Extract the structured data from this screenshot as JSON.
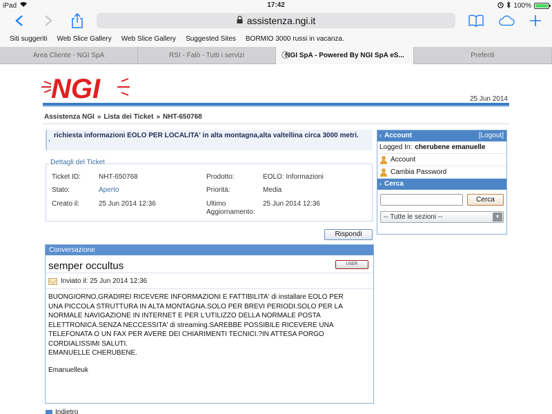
{
  "status_bar": {
    "device": "iPad",
    "time": "17:42",
    "battery": "100%",
    "battery_level": 1.0
  },
  "browser": {
    "url": "assistenza.ngi.it",
    "bookmarks": [
      "Siti suggeriti",
      "Web Slice Gallery",
      "Web Slice Gallery",
      "Suggested Sites",
      "BORMIO 3000 russi in vacanza."
    ],
    "tabs": [
      {
        "label": "Area Cliente - NGI SpA"
      },
      {
        "label": "RSI - Falò - Tutti i servizi"
      },
      {
        "label": "NGI SpA - Powered By NGI SpA eS..."
      },
      {
        "label": "Preferiti"
      }
    ]
  },
  "header": {
    "logo_text": "NGI",
    "date": "25 Jun 2014"
  },
  "breadcrumb": [
    "Assistenza NGI",
    "»",
    "Lista dei Ticket",
    "»",
    "NHT-650768"
  ],
  "ticket": {
    "subject": "richiesta informazioni EOLO PER LOCALITA' in alta montagna,alta valtellina circa 3000 metri.",
    "details_title": "Dettagli del Ticket",
    "fields": {
      "id_label": "Ticket ID:",
      "id_value": "NHT-650768",
      "product_label": "Prodotto:",
      "product_value": "EOLO: Informazioni",
      "status_label": "Stato:",
      "status_value": "Aperto",
      "priority_label": "Priorità:",
      "priority_value": "Media",
      "created_label": "Creato il:",
      "created_value": "25 Jun 2014 12:36",
      "updated_label": "Ultimo Aggiornamento:",
      "updated_value": "25 Jun 2014 12:36"
    },
    "reply_button": "Rispondi"
  },
  "conversation": {
    "title": "Conversazione",
    "author": "semper occultus",
    "badge": "USER",
    "sent": "Inviato il: 25 Jun 2014 12:36",
    "message": "BUONGIORNO,GRADIREI RICEVERE INFORMAZIONI E FATTIBILITA' di installare EOLO PER\nUNA PICCOLA STRUTTURA IN ALTA MONTAGNA.SOLO PER BREVI PERIODI.SOLO PER LA\nNORMALE NAVIGAZIONE IN INTERNET E PER L'UTILIZZO DELLA NORMALE POSTA\nELETTRONICA.SENZA NECCESSITA' di streaming.SAREBBE POSSIBILE RICEVERE UNA\nTELEFONATA O UN FAX PER AVERE DEI CHIARIMENTI TECNICI.?IN ATTESA PORGO\nCORDIALISSIMI SALUTI.\nEMANUELLE CHERUBENE.",
    "signature": "Emanuelleuk",
    "back_link": "Indietro"
  },
  "sidebar": {
    "account_title": "Account",
    "logout": "[Logout]",
    "logged_in_label": "Logged In:",
    "logged_in_user": "cherubene emanuelle",
    "account_link": "Account",
    "password_link": "Cambia Password",
    "search_title": "Cerca",
    "search_value": "",
    "search_button": "Cerca",
    "section_select": "-- Tutte le sezioni --"
  }
}
